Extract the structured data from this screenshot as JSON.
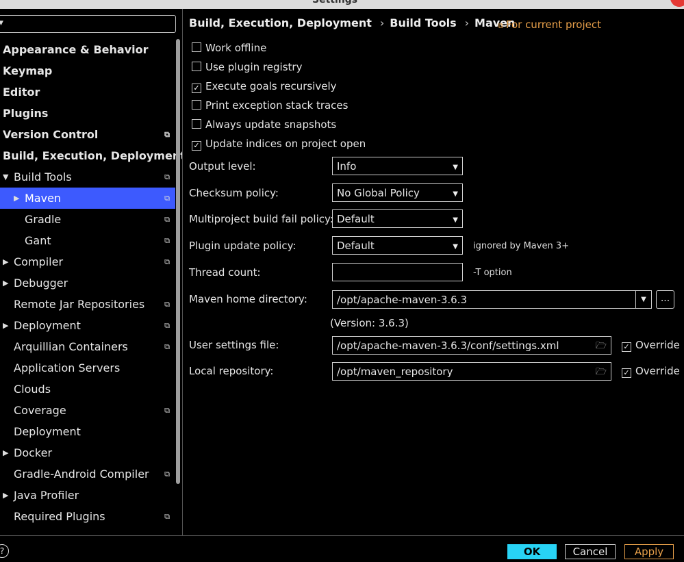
{
  "window": {
    "title": "Settings"
  },
  "sidebar": {
    "items": [
      {
        "label": "Appearance & Behavior",
        "bold": true,
        "indent": 0,
        "arrow": "",
        "copy": false
      },
      {
        "label": "Keymap",
        "bold": true,
        "indent": 0,
        "arrow": "",
        "copy": false
      },
      {
        "label": "Editor",
        "bold": true,
        "indent": 0,
        "arrow": "",
        "copy": false
      },
      {
        "label": "Plugins",
        "bold": true,
        "indent": 0,
        "arrow": "",
        "copy": false
      },
      {
        "label": "Version Control",
        "bold": true,
        "indent": 0,
        "arrow": "",
        "copy": true
      },
      {
        "label": "Build, Execution, Deployment",
        "bold": true,
        "indent": 0,
        "arrow": "",
        "copy": false
      },
      {
        "label": "Build Tools",
        "bold": false,
        "indent": 1,
        "arrow": "down",
        "copy": true
      },
      {
        "label": "Maven",
        "bold": false,
        "indent": 2,
        "arrow": "right",
        "copy": true,
        "selected": true
      },
      {
        "label": "Gradle",
        "bold": false,
        "indent": 2,
        "arrow": "",
        "copy": true
      },
      {
        "label": "Gant",
        "bold": false,
        "indent": 2,
        "arrow": "",
        "copy": true
      },
      {
        "label": "Compiler",
        "bold": false,
        "indent": 1,
        "arrow": "right",
        "copy": true
      },
      {
        "label": "Debugger",
        "bold": false,
        "indent": 1,
        "arrow": "right",
        "copy": false
      },
      {
        "label": "Remote Jar Repositories",
        "bold": false,
        "indent": 1,
        "arrow": "",
        "copy": true
      },
      {
        "label": "Deployment",
        "bold": false,
        "indent": 1,
        "arrow": "right",
        "copy": true
      },
      {
        "label": "Arquillian Containers",
        "bold": false,
        "indent": 1,
        "arrow": "",
        "copy": true
      },
      {
        "label": "Application Servers",
        "bold": false,
        "indent": 1,
        "arrow": "",
        "copy": false
      },
      {
        "label": "Clouds",
        "bold": false,
        "indent": 1,
        "arrow": "",
        "copy": false
      },
      {
        "label": "Coverage",
        "bold": false,
        "indent": 1,
        "arrow": "",
        "copy": true
      },
      {
        "label": "Deployment",
        "bold": false,
        "indent": 1,
        "arrow": "",
        "copy": false
      },
      {
        "label": "Docker",
        "bold": false,
        "indent": 1,
        "arrow": "right",
        "copy": false
      },
      {
        "label": "Gradle-Android Compiler",
        "bold": false,
        "indent": 1,
        "arrow": "",
        "copy": true
      },
      {
        "label": "Java Profiler",
        "bold": false,
        "indent": 1,
        "arrow": "right",
        "copy": false
      },
      {
        "label": "Required Plugins",
        "bold": false,
        "indent": 1,
        "arrow": "",
        "copy": true
      }
    ]
  },
  "breadcrumb": {
    "part1": "Build, Execution, Deployment",
    "part2": "Build Tools",
    "part3": "Maven",
    "separator": "›"
  },
  "scope": {
    "label": "For current project"
  },
  "checkboxes": [
    {
      "label": "Work offline",
      "checked": false
    },
    {
      "label": "Use plugin registry",
      "checked": false
    },
    {
      "label": "Execute goals recursively",
      "checked": true
    },
    {
      "label": "Print exception stack traces",
      "checked": false
    },
    {
      "label": "Always update snapshots",
      "checked": false
    },
    {
      "label": "Update indices on project open",
      "checked": true
    }
  ],
  "form": {
    "output_level": {
      "label": "Output level:",
      "value": "Info"
    },
    "checksum_policy": {
      "label": "Checksum policy:",
      "value": "No Global Policy"
    },
    "multiproject_fail": {
      "label": "Multiproject build fail policy:",
      "value": "Default"
    },
    "plugin_update": {
      "label": "Plugin update policy:",
      "value": "Default",
      "hint": "ignored by Maven 3+"
    },
    "thread_count": {
      "label": "Thread count:",
      "value": "",
      "hint": "-T option"
    },
    "maven_home": {
      "label": "Maven home directory:",
      "value": "/opt/apache-maven-3.6.3",
      "browse": "...",
      "version": "(Version: 3.6.3)"
    },
    "user_settings": {
      "label": "User settings file:",
      "value": "/opt/apache-maven-3.6.3/conf/settings.xml",
      "override": "Override",
      "override_checked": true
    },
    "local_repo": {
      "label": "Local repository:",
      "value": "/opt/maven_repository",
      "override": "Override",
      "override_checked": true
    }
  },
  "buttons": {
    "ok": "OK",
    "cancel": "Cancel",
    "apply": "Apply",
    "help": "?"
  },
  "colors": {
    "selection": "#3d5afe",
    "ok": "#28d3f5",
    "accent": "#e8a04a"
  }
}
